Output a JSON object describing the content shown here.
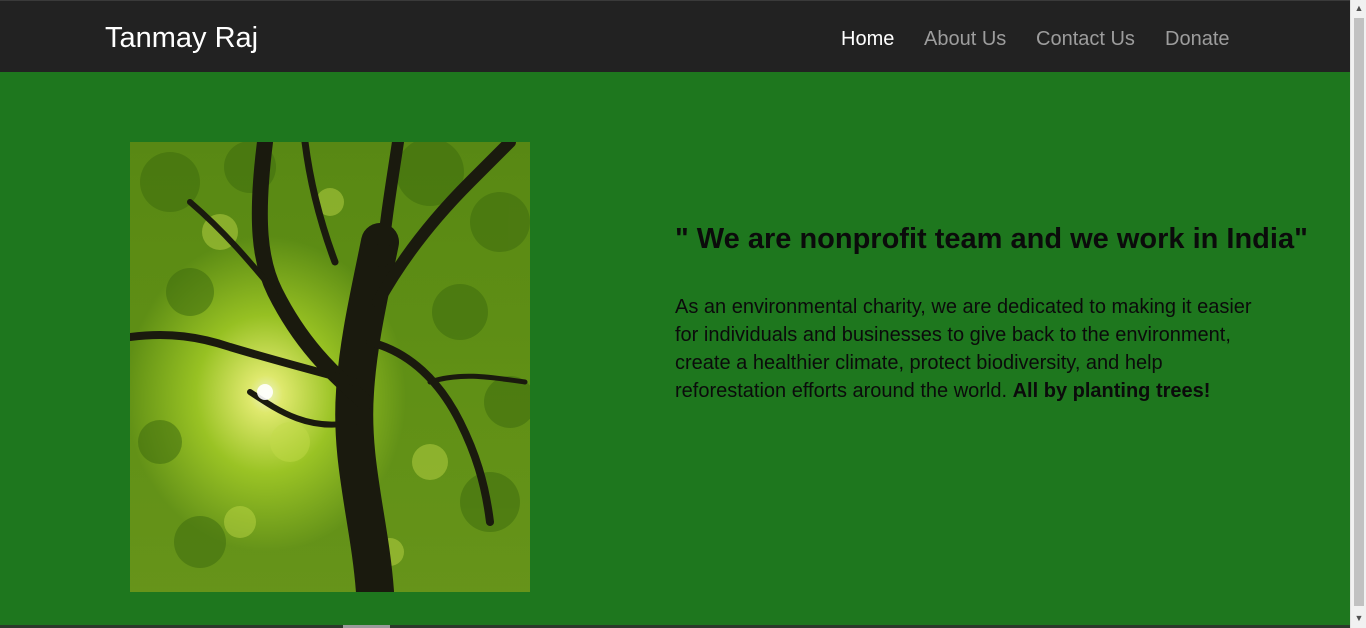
{
  "navbar": {
    "brand": "Tanmay Raj",
    "links": [
      {
        "label": "Home",
        "active": true
      },
      {
        "label": "About Us",
        "active": false
      },
      {
        "label": "Contact Us",
        "active": false
      },
      {
        "label": "Donate",
        "active": false
      }
    ]
  },
  "hero": {
    "image": "tree-canopy-sunlight-photo",
    "headline": "\" We are nonprofit team and we work in India\"",
    "description": "As an environmental charity, we are dedicated to making it easier for individuals and businesses to give back to the environment, create a healthier climate, protect biodiversity, and help reforestation efforts around the world.",
    "description_bold": "All by planting trees!"
  },
  "colors": {
    "navbar_bg": "#222222",
    "page_bg": "#1e771e",
    "nav_active": "#ffffff",
    "nav_inactive": "#9d9d9d"
  },
  "icons": {
    "scroll_up": "triangle-up-icon",
    "scroll_down": "triangle-down-icon"
  }
}
